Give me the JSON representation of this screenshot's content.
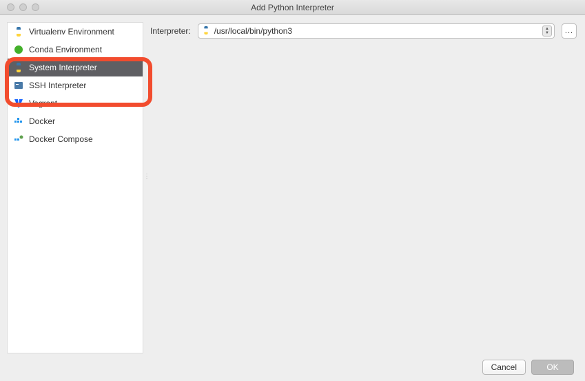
{
  "window": {
    "title": "Add Python Interpreter"
  },
  "sidebar": {
    "items": [
      {
        "label": "Virtualenv Environment",
        "icon": "python-icon",
        "selected": false
      },
      {
        "label": "Conda Environment",
        "icon": "conda-icon",
        "selected": false
      },
      {
        "label": "System Interpreter",
        "icon": "python-icon",
        "selected": true
      },
      {
        "label": "SSH Interpreter",
        "icon": "ssh-icon",
        "selected": false
      },
      {
        "label": "Vagrant",
        "icon": "vagrant-icon",
        "selected": false
      },
      {
        "label": "Docker",
        "icon": "docker-icon",
        "selected": false
      },
      {
        "label": "Docker Compose",
        "icon": "docker-compose-icon",
        "selected": false
      }
    ]
  },
  "main": {
    "interpreter_label": "Interpreter:",
    "interpreter_value": "/usr/local/bin/python3",
    "browse_label": "..."
  },
  "footer": {
    "cancel_label": "Cancel",
    "ok_label": "OK"
  }
}
